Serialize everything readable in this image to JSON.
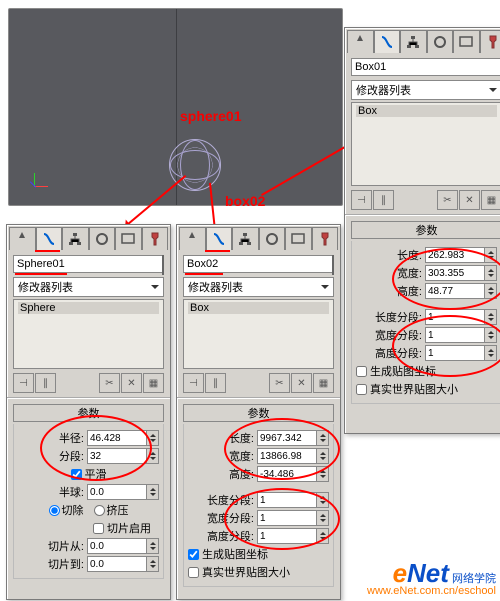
{
  "viewport": {
    "label_sphere": "sphere01",
    "label_box": "box02"
  },
  "panel_sphere": {
    "object_name": "Sphere01",
    "swatch_color": "#b3aed6",
    "modifier_label": "修改器列表",
    "stack_items": [
      "Sphere"
    ],
    "rollup_title": "参数",
    "radius_label": "半径:",
    "radius": "46.428",
    "segs_label": "分段:",
    "segs": "32",
    "smooth_label": "平滑",
    "smooth_checked": true,
    "hemi_label": "半球:",
    "hemi": "0.0",
    "chop_label": "切除",
    "squash_label": "挤压",
    "chop_selected": true,
    "slice_on_label": "切片启用",
    "slice_on_checked": false,
    "slice_from_label": "切片从:",
    "slice_from": "0.0",
    "slice_to_label": "切片到:",
    "slice_to": "0.0"
  },
  "panel_box02": {
    "object_name": "Box02",
    "swatch_color": "#8a4a1a",
    "modifier_label": "修改器列表",
    "stack_items": [
      "Box"
    ],
    "rollup_title": "参数",
    "len_label": "长度:",
    "len": "9967.342",
    "wid_label": "宽度:",
    "wid": "13866.98",
    "hei_label": "高度:",
    "hei": "-34.486",
    "lseg_label": "长度分段:",
    "lseg": "1",
    "wseg_label": "宽度分段:",
    "wseg": "1",
    "hseg_label": "高度分段:",
    "hseg": "1",
    "gen_uv_label": "生成贴图坐标",
    "gen_uv_checked": true,
    "real_world_label": "真实世界贴图大小",
    "real_world_checked": false
  },
  "panel_box01": {
    "object_name": "Box01",
    "swatch_color": "#9a5a1a",
    "modifier_label": "修改器列表",
    "stack_items": [
      "Box"
    ],
    "rollup_title": "参数",
    "len_label": "长度:",
    "len": "262.983",
    "wid_label": "宽度:",
    "wid": "303.355",
    "hei_label": "高度:",
    "hei": "48.77",
    "lseg_label": "长度分段:",
    "lseg": "1",
    "wseg_label": "宽度分段:",
    "wseg": "1",
    "hseg_label": "高度分段:",
    "hseg": "1",
    "gen_uv_label": "生成贴图坐标",
    "gen_uv_checked": false,
    "real_world_label": "真实世界贴图大小",
    "real_world_checked": false
  },
  "watermark": {
    "brand_e": "e",
    "brand_rest": "Net",
    "cn": "网络学院",
    "url": "www.eNet.com.cn/eschool"
  }
}
